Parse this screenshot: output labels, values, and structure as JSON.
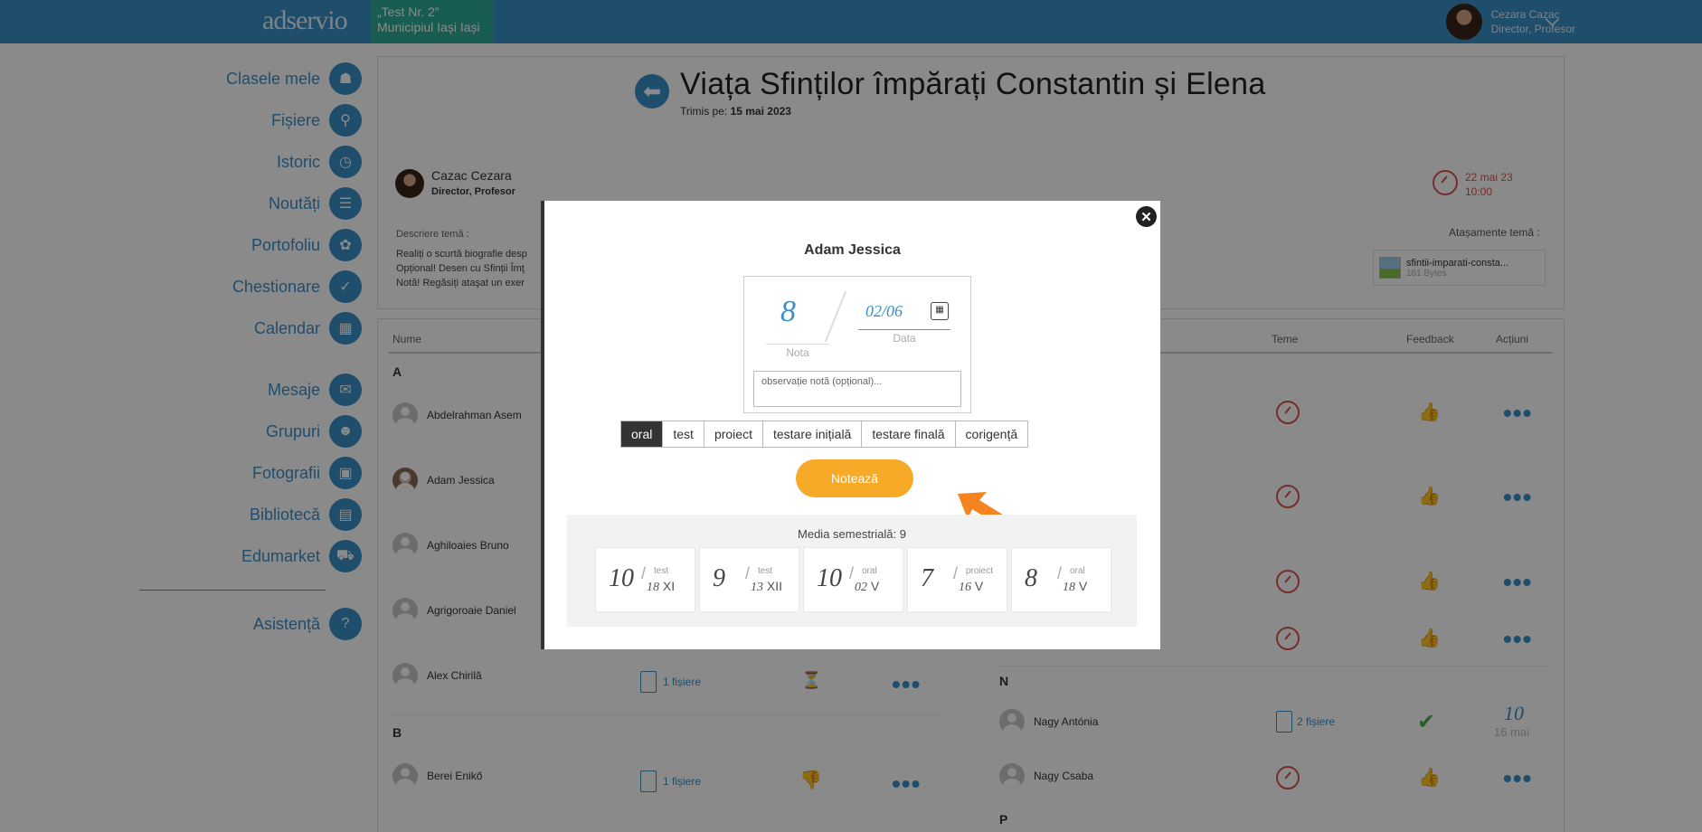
{
  "topbar": {
    "logo": "adservio",
    "school_line1": "„Test Nr. 2”",
    "school_line2": "Municipiul Iași Iași",
    "user_name": "Cezara Cazac",
    "user_role": "Director, Profesor"
  },
  "sidebar": {
    "items": [
      {
        "label": "Clasele mele",
        "icon": "classes-icon"
      },
      {
        "label": "Fișiere",
        "icon": "paperclip-icon"
      },
      {
        "label": "Istoric",
        "icon": "history-icon"
      },
      {
        "label": "Noutăți",
        "icon": "news-icon"
      },
      {
        "label": "Portofoliu",
        "icon": "portfolio-icon"
      },
      {
        "label": "Chestionare",
        "icon": "checklist-icon"
      },
      {
        "label": "Calendar",
        "icon": "calendar-icon"
      },
      {
        "label": "Mesaje",
        "icon": "mail-icon"
      },
      {
        "label": "Grupuri",
        "icon": "groups-icon"
      },
      {
        "label": "Fotografii",
        "icon": "photos-icon"
      },
      {
        "label": "Bibliotecă",
        "icon": "library-icon"
      },
      {
        "label": "Edumarket",
        "icon": "cart-icon"
      }
    ],
    "help": "Asistență"
  },
  "assignment": {
    "title": "Viața Sfinților împărați Constantin și Elena",
    "sent_label": "Trimis pe:",
    "sent_date": "15 mai 2023",
    "author_name": "Cazac Cezara",
    "author_role": "Director, Profesor",
    "due_date": "22 mai 23",
    "due_time": "10:00",
    "desc_label": "Descriere temă :",
    "desc_lines": [
      "Realiți o scurtă biografie desp",
      "Opțional! Desen cu Sfinții Îmţ",
      "Notă! Regăsiți ataşat un exer"
    ],
    "attach_label": "Atașamente temă :",
    "attach_name": "sfintii-imparati-consta...",
    "attach_size": "161 Bytes"
  },
  "table": {
    "headers": {
      "nume": "Nume",
      "teme": "Teme",
      "feedback": "Feedback",
      "actiuni": "Acțiuni"
    },
    "left_rows": [
      {
        "letter": "A"
      },
      {
        "name": "Abdelrahman Asem"
      },
      {
        "name": "Adam Jessica"
      },
      {
        "name": "Aghiloaies Bruno"
      },
      {
        "name": "Agrigoroaie Daniel"
      },
      {
        "name": "Alex Chirilă",
        "files": "1 fișiere"
      },
      {
        "letter": "B"
      },
      {
        "name": "Berei Enikő",
        "files": "1 fișiere"
      }
    ],
    "right_rows": [
      {
        "letter": "N"
      },
      {
        "name": "Nagy Antónia",
        "files": "2 fișiere",
        "grade": "10",
        "grade_date": "16 mai"
      },
      {
        "name": "Nagy Csaba"
      },
      {
        "letter": "P"
      }
    ]
  },
  "modal": {
    "student": "Adam Jessica",
    "grade": "8",
    "grade_label": "Nota",
    "date": "02/06",
    "date_label": "Data",
    "obs_placeholder": "observație notă (opțional)...",
    "types": [
      "oral",
      "test",
      "proiect",
      "testare inițială",
      "testare finală",
      "corigență"
    ],
    "selected_type": "oral",
    "submit": "Notează",
    "average": "Media semestrială: 9",
    "grades": [
      {
        "value": "10",
        "type": "test",
        "day": "18",
        "month": "XI"
      },
      {
        "value": "9",
        "type": "test",
        "day": "13",
        "month": "XII"
      },
      {
        "value": "10",
        "type": "oral",
        "day": "02",
        "month": "V"
      },
      {
        "value": "7",
        "type": "proiect",
        "day": "16",
        "month": "V"
      },
      {
        "value": "8",
        "type": "oral",
        "day": "18",
        "month": "V"
      }
    ]
  },
  "colors": {
    "primary": "#3a8fc7",
    "teal": "#2eab9c",
    "accent": "#f7a928",
    "danger": "#d9534f"
  }
}
